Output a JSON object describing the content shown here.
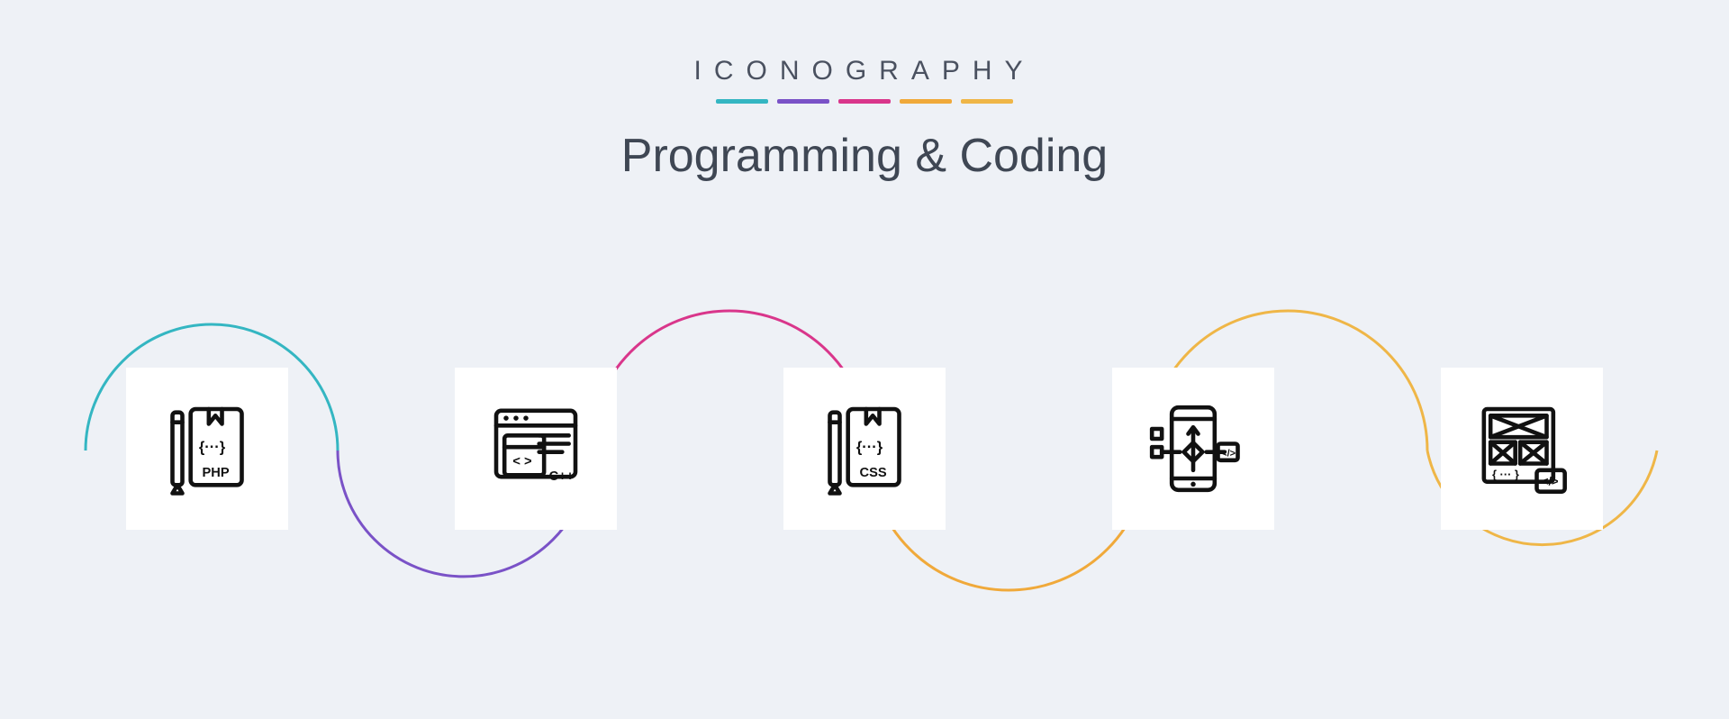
{
  "header": {
    "brand": "ICONOGRAPHY",
    "title": "Programming & Coding"
  },
  "accents": [
    "#34b6c2",
    "#7a52c7",
    "#d9368b",
    "#f0a93a",
    "#efb647"
  ],
  "wave_colors": [
    "#34b6c2",
    "#7a52c7",
    "#d9368b",
    "#f0a93a",
    "#efb647"
  ],
  "icons": [
    {
      "name": "php-file-icon",
      "label": "PHP"
    },
    {
      "name": "cpp-browser-icon",
      "label": "C++"
    },
    {
      "name": "css-file-icon",
      "label": "CSS"
    },
    {
      "name": "mobile-flow-icon",
      "label": ""
    },
    {
      "name": "wireframe-code-icon",
      "label": ""
    }
  ]
}
